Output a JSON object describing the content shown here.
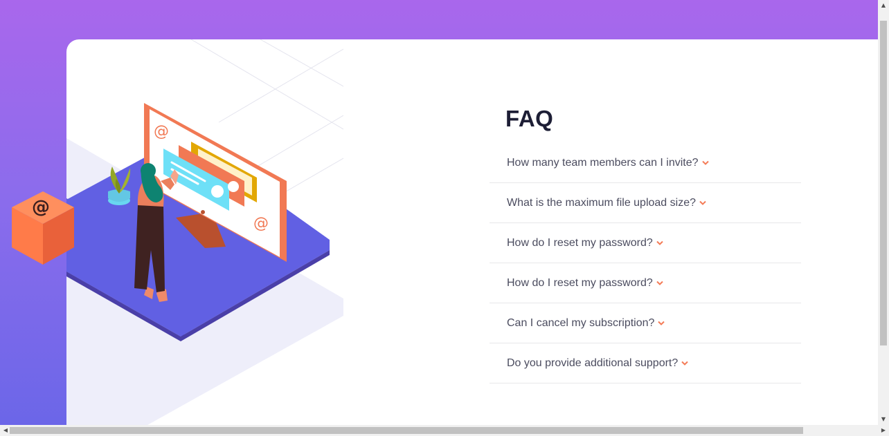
{
  "faq": {
    "title": "FAQ",
    "items": [
      {
        "question": "How many team members can I invite?"
      },
      {
        "question": "What is the maximum file upload size?"
      },
      {
        "question": "How do I reset my password?"
      },
      {
        "question": "How do I reset my password?"
      },
      {
        "question": "Can I cancel my subscription?"
      },
      {
        "question": "Do you provide additional support?"
      }
    ],
    "arrow_icon": "chevron-down-icon"
  },
  "colors": {
    "accent": "#f47b56",
    "title": "#1d1e35",
    "text": "#4b4c5f",
    "bg_top": "#a967ec",
    "bg_bottom": "#6a66e8"
  }
}
